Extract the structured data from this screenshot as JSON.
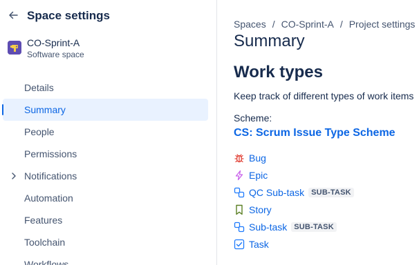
{
  "sidebar": {
    "title": "Space settings",
    "space": {
      "name": "CO-Sprint-A",
      "type": "Software space"
    },
    "items": [
      {
        "label": "Details"
      },
      {
        "label": "Summary"
      },
      {
        "label": "People"
      },
      {
        "label": "Permissions"
      },
      {
        "label": "Notifications"
      },
      {
        "label": "Automation"
      },
      {
        "label": "Features"
      },
      {
        "label": "Toolchain"
      },
      {
        "label": "Workflows"
      }
    ],
    "active_item": "Summary"
  },
  "main": {
    "breadcrumb": [
      "Spaces",
      "CO-Sprint-A",
      "Project settings"
    ],
    "breadcrumb_sep": "/",
    "page_title": "Summary",
    "section_title": "Work types",
    "section_desc": "Keep track of different types of work items",
    "scheme_label": "Scheme:",
    "scheme_name": "CS: Scrum Issue Type Scheme",
    "work_types": [
      {
        "name": "Bug",
        "icon": "bug-icon",
        "color": "#e2483d",
        "badge": ""
      },
      {
        "name": "Epic",
        "icon": "lightning-icon",
        "color": "#c964ea",
        "badge": ""
      },
      {
        "name": "QC Sub-task",
        "icon": "subtask-icon",
        "color": "#1d7afc",
        "badge": "SUB-TASK"
      },
      {
        "name": "Story",
        "icon": "bookmark-icon",
        "color": "#5b7f24",
        "badge": ""
      },
      {
        "name": "Sub-task",
        "icon": "subtask-icon",
        "color": "#1d7afc",
        "badge": "SUB-TASK"
      },
      {
        "name": "Task",
        "icon": "checkbox-icon",
        "color": "#1d7afc",
        "badge": ""
      }
    ]
  },
  "colors": {
    "accent": "#0c66e4",
    "active_bg": "#e9f2ff",
    "text": "#172b4d",
    "subtle": "#44546f"
  }
}
